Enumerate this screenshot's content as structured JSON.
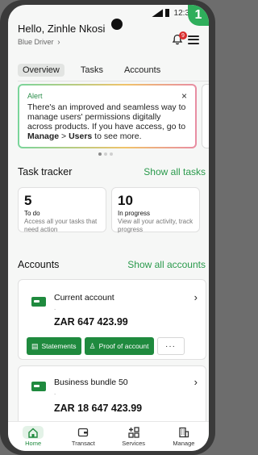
{
  "corner_badge": "1",
  "status": {
    "time": "12:3"
  },
  "header": {
    "greeting": "Hello, Zinhle Nkosi",
    "tier": "Blue Driver",
    "bell_count": "9"
  },
  "tabs": [
    {
      "label": "Overview",
      "active": true
    },
    {
      "label": "Tasks",
      "active": false
    },
    {
      "label": "Accounts",
      "active": false
    }
  ],
  "alert": {
    "title": "Alert",
    "close": "×",
    "text_before": "There's an improved and seamless way to manage users' permissions digitally across products. If you have access, go to ",
    "manage": "Manage",
    "sep": " > ",
    "users": "Users",
    "text_after": " to see more."
  },
  "task_tracker": {
    "title": "Task tracker",
    "link": "Show all tasks",
    "cards": [
      {
        "count": "5",
        "label": "To do",
        "desc": "Access all your tasks that need action"
      },
      {
        "count": "10",
        "label": "In progress",
        "desc": "View all your activity, track progress"
      }
    ]
  },
  "accounts": {
    "title": "Accounts",
    "link": "Show all accounts",
    "items": [
      {
        "name": "Current account",
        "sub": ".",
        "amount": "ZAR 647 423.99"
      },
      {
        "name": "Business bundle 50",
        "sub": ".",
        "amount": "ZAR 18 647 423.99"
      }
    ],
    "buttons": {
      "statements": "Statements",
      "proof": "Proof of account",
      "more": "···"
    }
  },
  "nav": [
    {
      "label": "Home",
      "icon": "home-icon",
      "active": true
    },
    {
      "label": "Transact",
      "icon": "wallet-icon",
      "active": false
    },
    {
      "label": "Services",
      "icon": "services-icon",
      "active": false
    },
    {
      "label": "Manage",
      "icon": "building-icon",
      "active": false
    }
  ],
  "colors": {
    "accent": "#1f8a3e",
    "link": "#2a9a4c",
    "badge": "#d92c2c"
  }
}
